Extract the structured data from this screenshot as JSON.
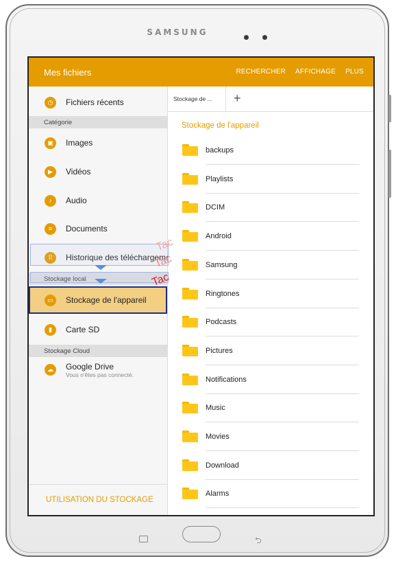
{
  "device": {
    "brand": "SAMSUNG"
  },
  "appbar": {
    "title": "Mes fichiers",
    "actions": [
      "RECHERCHER",
      "AFFICHAGE",
      "PLUS"
    ]
  },
  "sidebar": {
    "recent": "Fichiers récents",
    "category_header": "Catégorie",
    "categories": [
      {
        "label": "Images",
        "icon": "image-icon"
      },
      {
        "label": "Vidéos",
        "icon": "video-icon"
      },
      {
        "label": "Audio",
        "icon": "music-note-icon"
      },
      {
        "label": "Documents",
        "icon": "document-icon"
      },
      {
        "label": "Historique des téléchargeme",
        "icon": "download-history-icon"
      }
    ],
    "local_header": "Stockage local",
    "local": [
      {
        "label": "Stockage de l'appareil",
        "icon": "device-storage-icon",
        "selected": true
      },
      {
        "label": "Carte SD",
        "icon": "sd-card-icon"
      }
    ],
    "cloud_header": "Stockage Cloud",
    "cloud": [
      {
        "label": "Google Drive",
        "sub": "Vous n'êtes pas connecté.",
        "icon": "cloud-icon"
      }
    ],
    "storage_usage": "UTILISATION DU STOCKAGE"
  },
  "content": {
    "tab_label": "Stockage de ...",
    "tab_add": "+",
    "path_title": "Stockage de l'appareil",
    "folders": [
      "backups",
      "Playlists",
      "DCIM",
      "Android",
      "Samsung",
      "Ringtones",
      "Podcasts",
      "Pictures",
      "Notifications",
      "Music",
      "Movies",
      "Download",
      "Alarms"
    ]
  },
  "annotation": {
    "tap_text": [
      "Tac",
      "Tac",
      "Tac"
    ]
  },
  "colors": {
    "accent": "#e49c00",
    "selection_border": "#17308f",
    "selection_fill": "#f2cf83"
  }
}
